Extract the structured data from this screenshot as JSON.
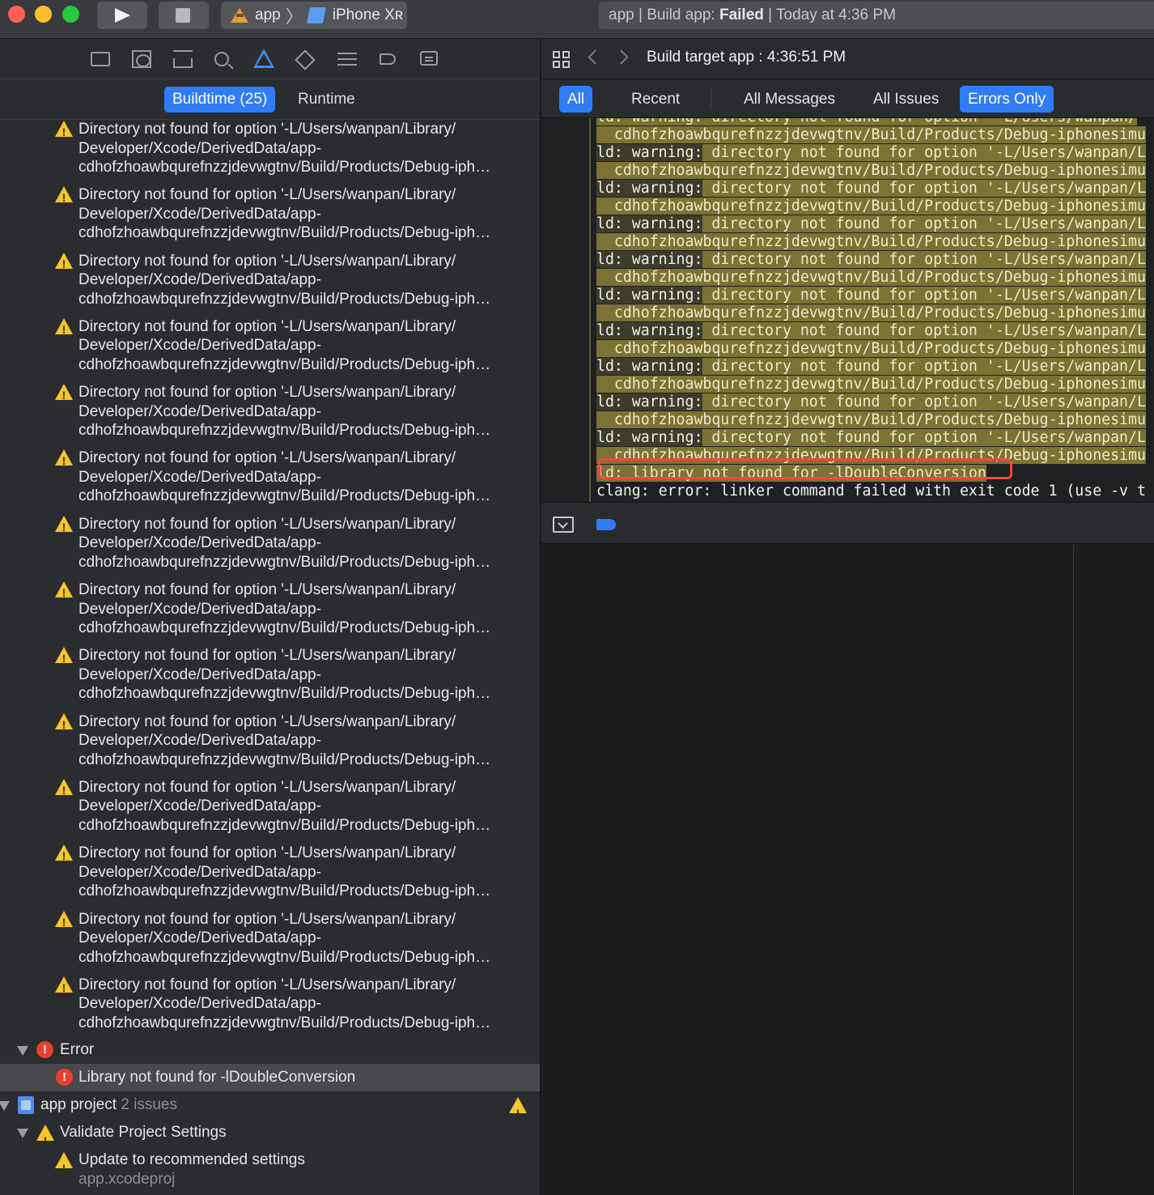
{
  "window": {
    "scheme_app": "app",
    "scheme_device": "iPhone Xʀ",
    "status_prefix": "app | Build app: ",
    "status_state": "Failed",
    "status_suffix": " | Today at 4:36 PM"
  },
  "navigator": {
    "tabs": [
      "Buildtime (25)",
      "Runtime"
    ],
    "warning_item": {
      "line1": "Directory not found for option '-L/Users/wanpan/Library/",
      "line2": "Developer/Xcode/DerivedData/app-",
      "line3": "cdhofzhoawbqurefnzzjdevwgtnv/Build/Products/Debug-iph…"
    },
    "error_group": "Error",
    "error_item": "Library not found for -lDoubleConversion",
    "project": {
      "name": "app project",
      "issues": "2 issues"
    },
    "validate_group": "Validate Project Settings",
    "update_item": "Update to recommended settings",
    "update_sub": "app.xcodeproj"
  },
  "editor": {
    "jump_title": "Build target app : 4:36:51 PM",
    "filters": [
      "All",
      "Recent",
      "All Messages",
      "All Issues",
      "Errors Only"
    ],
    "log": {
      "top_fragment": "ld: warning: directory not found for option '-L/Users/wanpan/",
      "warn_prefix": "ld: warning:",
      "warn_text": " directory not found for option '-L/Users/wanpan/L",
      "path_line": "  cdhofzhoawbqurefnzzjdevwgtnv/Build/Products/Debug-iphonesimu",
      "partial_path": "  cdhofzhoawbqurefnzzjdevwgtnv/Build/Products/Debug-iphonesimu",
      "error_line": "ld: library not found for -lDoubleConversion",
      "clang_line": "clang: error: linker command failed with exit code 1 (use -v t"
    }
  },
  "colors": {
    "accent": "#2f7cf6",
    "warning": "#f5c52a",
    "error": "#e8412c",
    "highlight": "#7b7234",
    "annotation": "#f2473a"
  }
}
